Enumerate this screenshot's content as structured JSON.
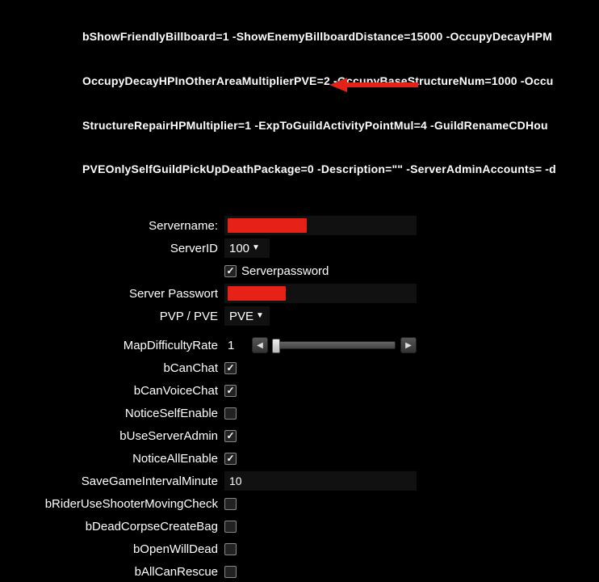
{
  "header": {
    "line1": "bShowFriendlyBillboard=1 -ShowEnemyBillboardDistance=15000 -OccupyDecayHPM",
    "line2": "OccupyDecayHPInOtherAreaMultiplierPVE=2 -OccupyBaseStructureNum=1000 -Occu",
    "line3": "StructureRepairHPMultiplier=1 -ExpToGuildActivityPointMul=4 -GuildRenameCDHou",
    "line4": "PVEOnlySelfGuildPickUpDeathPackage=0 -Description=\"\" -ServerAdminAccounts= -d"
  },
  "form": {
    "servername": {
      "label": "Servername:",
      "value": ""
    },
    "serverid": {
      "label": "ServerID",
      "value": "100"
    },
    "serverpassword_flag": {
      "label": "Serverpassword",
      "checked": true
    },
    "server_passwort": {
      "label": "Server Passwort",
      "value": ""
    },
    "pvp_pve": {
      "label": "PVP / PVE",
      "value": "PVE"
    },
    "map_difficulty": {
      "label": "MapDifficultyRate",
      "value": "1"
    },
    "b_can_chat": {
      "label": "bCanChat",
      "checked": true
    },
    "b_can_voice_chat": {
      "label": "bCanVoiceChat",
      "checked": true
    },
    "notice_self_enable": {
      "label": "NoticeSelfEnable",
      "checked": false
    },
    "b_use_server_admin": {
      "label": "bUseServerAdmin",
      "checked": true
    },
    "notice_all_enable": {
      "label": "NoticeAllEnable",
      "checked": true
    },
    "save_interval": {
      "label": "SaveGameIntervalMinute",
      "value": "10"
    },
    "b_rider_shooter": {
      "label": "bRiderUseShooterMovingCheck",
      "checked": false
    },
    "b_dead_corpse": {
      "label": "bDeadCorpseCreateBag",
      "checked": false
    },
    "b_open_will_dead": {
      "label": "bOpenWillDead",
      "checked": false
    },
    "b_all_can_rescue": {
      "label": "bAllCanRescue",
      "checked": false
    }
  },
  "colors": {
    "redact": "#e62117",
    "arrow": "#e62117"
  }
}
